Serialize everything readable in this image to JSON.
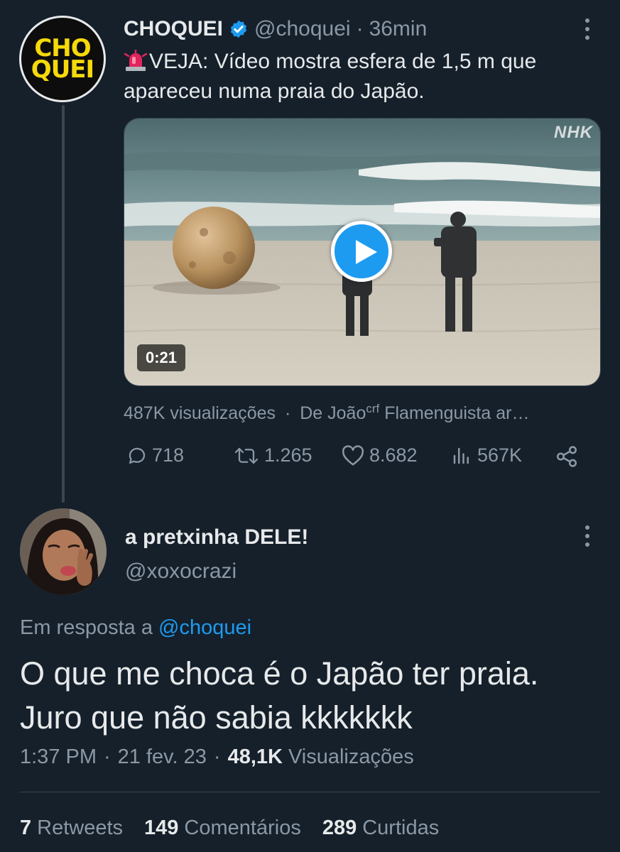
{
  "parent_tweet": {
    "avatar_text": [
      "CHO",
      "QUEI"
    ],
    "name": "CHOQUEI",
    "handle": "@choquei",
    "separator": "·",
    "time": "36min",
    "text": "VEJA: Vídeo mostra esfera de 1,5 m que apareceu numa praia do Japão.",
    "media": {
      "duration": "0:21",
      "watermark": "NHK"
    },
    "views_line": {
      "views": "487K visualizações",
      "dot": "·",
      "from_prefix": "De João",
      "superscript": "crf",
      "from_suffix": " Flamenguista ar…"
    },
    "actions": {
      "replies": "718",
      "retweets": "1.265",
      "likes": "8.682",
      "views": "567K"
    }
  },
  "reply_tweet": {
    "name": "a pretxinha DELE!",
    "handle": "@xoxocrazi",
    "replying_prefix": "Em resposta a",
    "replying_mention": "@choquei",
    "text_line1": "O que me choca é o Japão ter praia.",
    "text_line2": "Juro que não sabia kkkkkkk",
    "time": "1:37 PM",
    "date": "21 fev. 23",
    "separator": "·",
    "views_count": "48,1K",
    "views_label": "Visualizações",
    "stats": [
      {
        "num": "7",
        "label": "Retweets"
      },
      {
        "num": "149",
        "label": "Comentários"
      },
      {
        "num": "289",
        "label": "Curtidas"
      }
    ]
  },
  "colors": {
    "background": "#15202b",
    "accent": "#1d9bf0",
    "secondary_text": "#8b98a5",
    "choquei_yellow": "#f5d90a"
  }
}
